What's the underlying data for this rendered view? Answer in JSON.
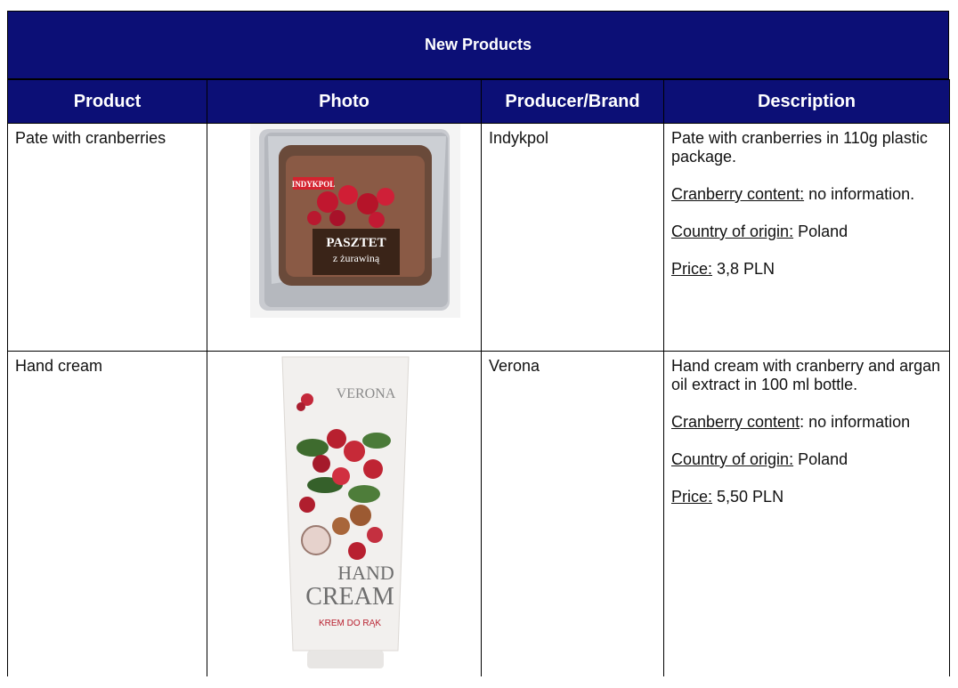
{
  "header": {
    "title": "New Products"
  },
  "columns": [
    "Product",
    "Photo",
    "Producer/Brand",
    "Description"
  ],
  "rows": [
    {
      "product": "Pate with cranberries",
      "brand": "Indykpol",
      "desc_intro": "Pate with cranberries in 110g plastic package.",
      "cranberry_label": "Cranberry content:",
      "cranberry_value": " no information.",
      "origin_label": "Country of origin:",
      "origin_value": " Poland",
      "price_label": "Price:",
      "price_value": " 3,8 PLN",
      "package_text": {
        "brand": "INDYKPOL",
        "name": "PASZTET",
        "sub": "z żurawiną"
      }
    },
    {
      "product": "Hand cream",
      "brand": "Verona",
      "desc_intro": "Hand cream with cranberry and argan oil extract in 100 ml bottle.",
      "cranberry_label": "Cranberry content",
      "cranberry_value": ": no information",
      "origin_label": "Country of origin:",
      "origin_value": " Poland",
      "price_label": "Price:",
      "price_value": " 5,50 PLN",
      "package_text": {
        "brand": "VERONA",
        "name1": "HAND",
        "name2": "CREAM",
        "sub": "KREM DO RĄK"
      }
    }
  ],
  "colors": {
    "header_bg": "#0c0f76",
    "header_text": "#ffffff"
  }
}
